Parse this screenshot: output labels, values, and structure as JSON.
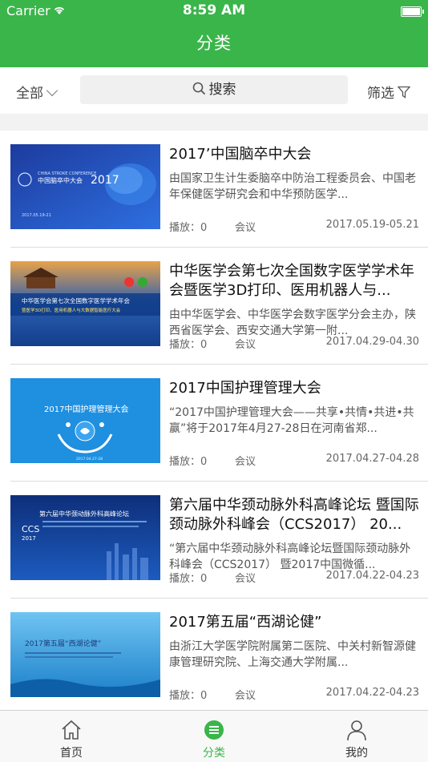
{
  "status_bar": {
    "carrier": "Carrier",
    "time": "8:59 AM"
  },
  "header": {
    "title": "分类"
  },
  "filters": {
    "all_label": "全部",
    "search_label": "搜索",
    "filter_label": "筛选"
  },
  "colors": {
    "brand_green": "#3ab54a"
  },
  "items": [
    {
      "title": "2017’中国脑卒中大会",
      "desc": "由国家卫生计生委脑卒中防治工程委员会、中国老年保健医学研究会和中华预防医学...",
      "plays": "播放：0",
      "category": "会议",
      "date": "2017.05.19-05.21",
      "thumb_text": "中国脑卒中大会2017",
      "thumb_sub": "CHINA STROKE CONFERENCE",
      "thumb_date": "2017.05.19-21"
    },
    {
      "title": "中华医学会第七次全国数字医学学术年会暨医学3D打印、医用机器人与...",
      "desc": "由中华医学会、中华医学会数字医学分会主办，陕西省医学会、西安交通大学第一附...",
      "plays": "播放：0",
      "category": "会议",
      "date": "2017.04.29-04.30",
      "thumb_text": "中华医学会第七次全国数字医学学术年会",
      "thumb_sub": "暨医学3D打印、医用机器人与大数据智能医疗大会"
    },
    {
      "title": "2017中国护理管理大会",
      "desc": "“2017中国护理管理大会——共享•共情•共进•共赢”将于2017年4月27-28日在河南省郑...",
      "plays": "播放：0",
      "category": "会议",
      "date": "2017.04.27-04.28",
      "thumb_text": "2017中国护理管理大会",
      "thumb_date": "2017.04.27-28"
    },
    {
      "title": "第六届中华颈动脉外科高峰论坛 暨国际颈动脉外科峰会（CCS2017） 20...",
      "desc": "“第六届中华颈动脉外科高峰论坛暨国际颈动脉外科峰会（CCS2017） 暨2017中国微循...",
      "plays": "播放：0",
      "category": "会议",
      "date": "2017.04.22-04.23",
      "thumb_text": "第六届中华颈动脉外科高峰论坛",
      "thumb_sub": "CCS 2017"
    },
    {
      "title": "2017第五届“西湖论健”",
      "desc": "由浙江大学医学院附属第二医院、中关村新智源健康管理研究院、上海交通大学附属...",
      "plays": "播放：0",
      "category": "会议",
      "date": "2017.04.22-04.23",
      "thumb_text": "2017第五届“西湖论健”"
    }
  ],
  "tabs": [
    {
      "label": "首页",
      "icon": "home-icon"
    },
    {
      "label": "分类",
      "icon": "category-icon"
    },
    {
      "label": "我的",
      "icon": "profile-icon"
    }
  ]
}
